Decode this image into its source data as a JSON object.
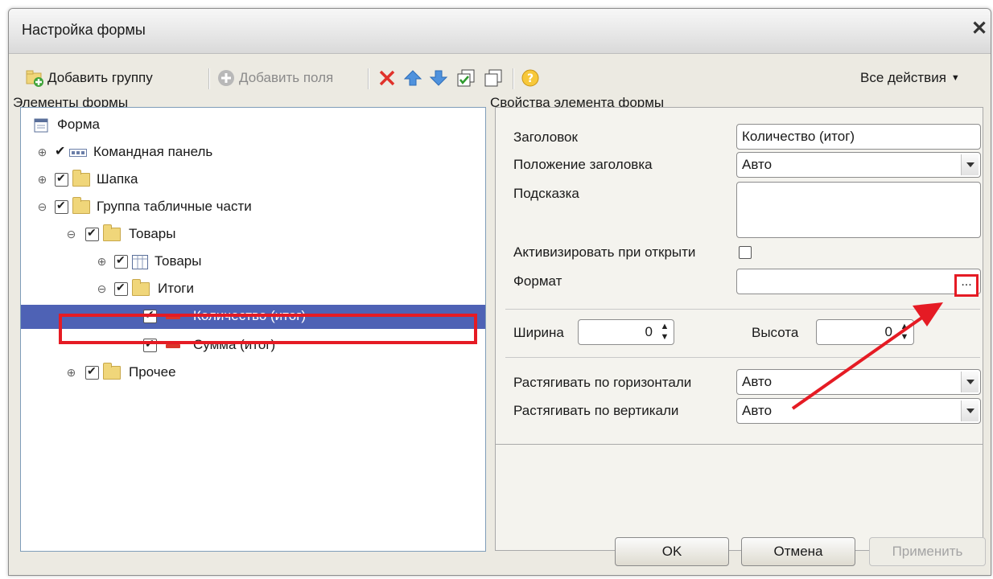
{
  "window": {
    "title": "Настройка формы"
  },
  "toolbar": {
    "add_group": "Добавить группу",
    "add_fields": "Добавить поля",
    "all_actions": "Все действия"
  },
  "left_panel": {
    "label": "Элементы формы",
    "tree": [
      {
        "label": "Форма",
        "level": 0,
        "expander": "",
        "checked": null,
        "icon": "form-icon"
      },
      {
        "label": "Командная панель",
        "level": 0,
        "expander": "⊕",
        "checked": true,
        "icon": "command-panel-icon"
      },
      {
        "label": "Шапка",
        "level": 0,
        "expander": "⊕",
        "checked": true,
        "icon": "folder-icon"
      },
      {
        "label": "Группа табличные части",
        "level": 0,
        "expander": "⊖",
        "checked": true,
        "icon": "folder-icon"
      },
      {
        "label": "Товары",
        "level": 1,
        "expander": "⊖",
        "checked": true,
        "icon": "folder-icon"
      },
      {
        "label": "Товары",
        "level": 2,
        "expander": "⊕",
        "checked": true,
        "icon": "table-icon"
      },
      {
        "label": "Итоги",
        "level": 2,
        "expander": "⊖",
        "checked": true,
        "icon": "folder-icon"
      },
      {
        "label": "Количество (итог)",
        "level": 3,
        "expander": "",
        "checked": true,
        "icon": "field-icon",
        "selected": true
      },
      {
        "label": "Сумма (итог)",
        "level": 3,
        "expander": "",
        "checked": true,
        "icon": "field-icon"
      },
      {
        "label": "Прочее",
        "level": 1,
        "expander": "⊕",
        "checked": true,
        "icon": "folder-icon"
      }
    ]
  },
  "right_panel": {
    "label": "Свойства элемента формы",
    "title_label": "Заголовок",
    "title_value": "Количество (итог)",
    "title_pos_label": "Положение заголовка",
    "title_pos_value": "Авто",
    "hint_label": "Подсказка",
    "hint_value": "",
    "activate_label": "Активизировать при открыти",
    "format_label": "Формат",
    "format_value": "",
    "format_button": "...",
    "width_label": "Ширина",
    "width_value": "0",
    "height_label": "Высота",
    "height_value": "0",
    "stretch_h_label": "Растягивать по горизонтали",
    "stretch_h_value": "Авто",
    "stretch_v_label": "Растягивать по вертикали",
    "stretch_v_value": "Авто"
  },
  "buttons": {
    "ok": "OK",
    "cancel": "Отмена",
    "apply": "Применить"
  },
  "colors": {
    "selection": "#4e62b5",
    "highlight": "#e51b24"
  }
}
